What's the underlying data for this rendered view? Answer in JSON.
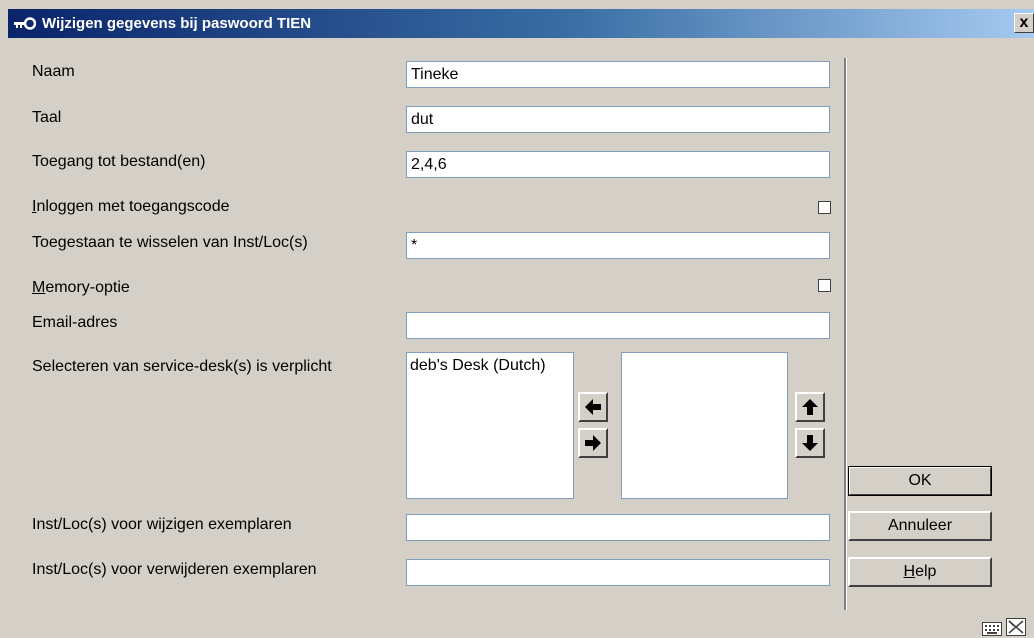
{
  "window": {
    "title": "Wijzigen gegevens bij paswoord TIEN",
    "close_label": "x"
  },
  "fields": {
    "naam": {
      "label": "Naam",
      "value": "Tineke"
    },
    "taal": {
      "label": "Taal",
      "value": "dut"
    },
    "toegang": {
      "label": "Toegang tot bestand(en)",
      "value": "2,4,6"
    },
    "inloggen": {
      "label_accel": "I",
      "label_rest": "nloggen met toegangscode",
      "checked": false
    },
    "wisselen": {
      "label": "Toegestaan te wisselen van Inst/Loc(s)",
      "value": "*"
    },
    "memory": {
      "label_accel": "M",
      "label_rest": "emory-optie",
      "checked": false
    },
    "email": {
      "label": "Email-adres",
      "value": ""
    },
    "servicedesk": {
      "label": "Selecteren van service-desk(s) is verplicht",
      "available": [
        "deb's Desk (Dutch)"
      ],
      "selected": []
    },
    "wijzigen": {
      "label": "Inst/Loc(s) voor wijzigen exemplaren",
      "value": ""
    },
    "verwijderen": {
      "label": "Inst/Loc(s) voor verwijderen exemplaren",
      "value": ""
    }
  },
  "buttons": {
    "ok": "OK",
    "annuleer": "Annuleer",
    "help_accel": "H",
    "help_rest": "elp"
  },
  "icons": [
    "key-icon",
    "arrow-left-icon",
    "arrow-right-icon",
    "arrow-up-icon",
    "arrow-down-icon",
    "keyboard-icon",
    "resize-icon"
  ]
}
